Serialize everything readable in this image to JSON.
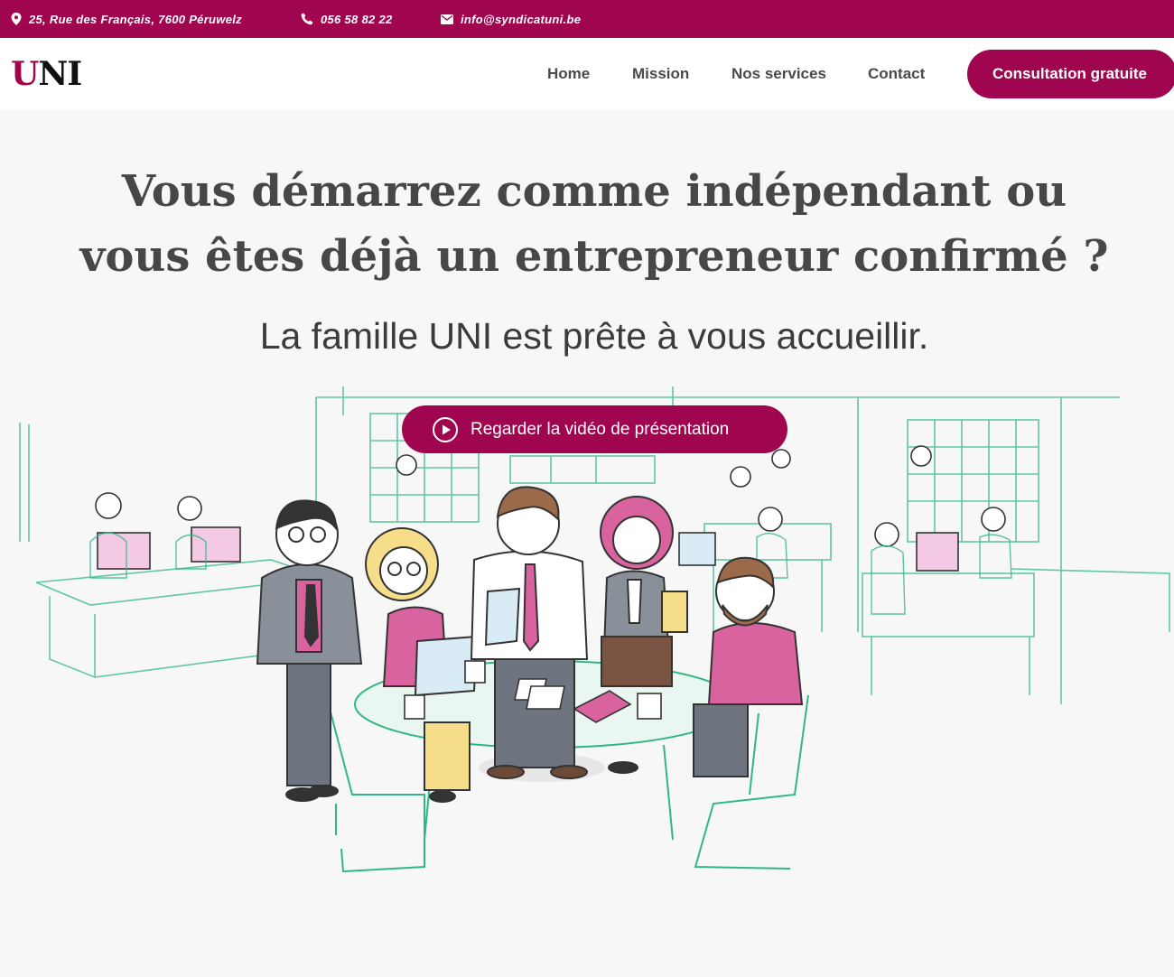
{
  "topbar": {
    "address": "25, Rue des Français, 7600 Péruwelz",
    "phone": "056 58 82 22",
    "email": "info@syndicatuni.be",
    "icons": [
      "map-pin-icon",
      "phone-icon",
      "envelope-icon"
    ]
  },
  "header": {
    "logo_u": "U",
    "logo_ni": "NI",
    "nav": [
      {
        "label": "Home"
      },
      {
        "label": "Mission"
      },
      {
        "label": "Nos services"
      },
      {
        "label": "Contact"
      }
    ],
    "cta_label": "Consultation gratuite"
  },
  "hero": {
    "title_line1": "Vous démarrez comme indépendant ou",
    "title_line2": "vous êtes déjà un entrepreneur confirmé ?",
    "subtitle": "La famille UNI est prête à vous accueillir.",
    "video_button_label": "Regarder la vidéo de présentation",
    "video_icon": "play-circle-icon"
  },
  "colors": {
    "brand": "#a0064f",
    "text": "#474747",
    "background": "#f7f7f7",
    "illustration_green": "#2fb885",
    "illustration_pink": "#d8639f"
  }
}
